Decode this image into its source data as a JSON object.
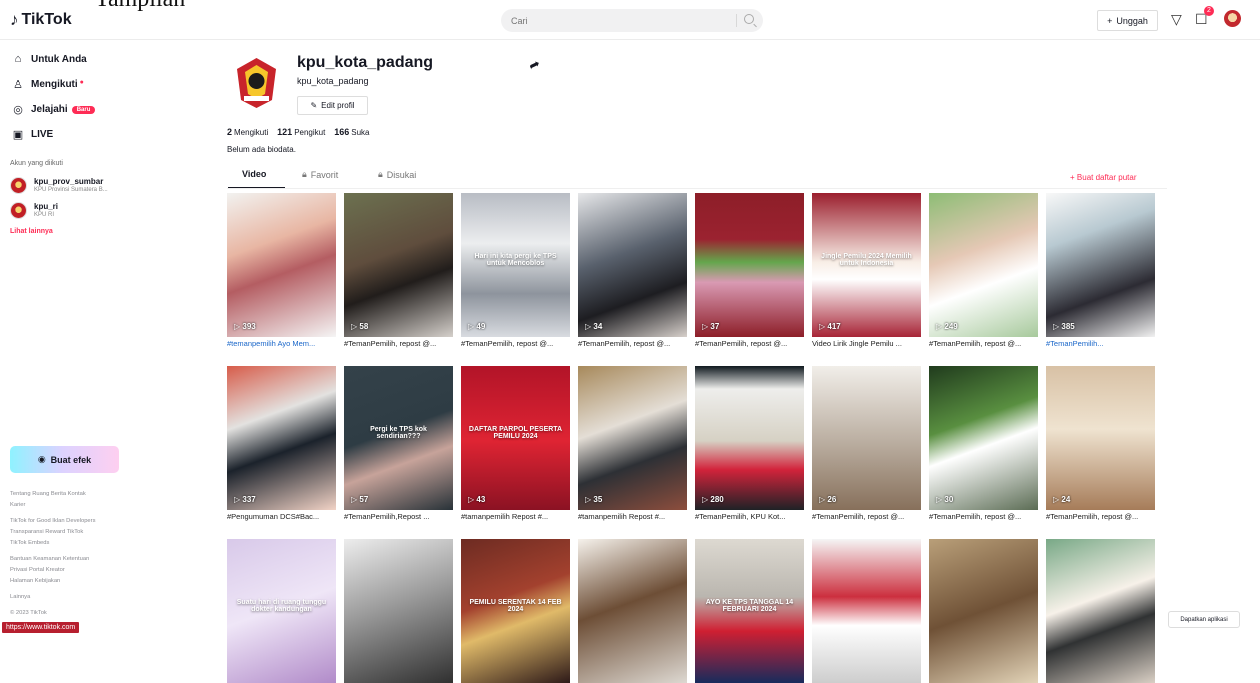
{
  "overlay_text": "Tampilan",
  "topbar": {
    "logo": "TikTok",
    "search_placeholder": "Cari",
    "upload_label": "Unggah",
    "notification_count": "2"
  },
  "sidebar": {
    "items": [
      {
        "label": "Untuk Anda"
      },
      {
        "label": "Mengikuti"
      },
      {
        "label": "Jelajahi",
        "pill": "Baru"
      },
      {
        "label": "LIVE"
      }
    ],
    "section_title": "Akun yang diikuti",
    "following": [
      {
        "name": "kpu_prov_sumbar",
        "sub": "KPU Provinsi Sumatera B..."
      },
      {
        "name": "kpu_ri",
        "sub": "KPU RI"
      }
    ],
    "more_label": "Lihat lainnya",
    "effect_label": "Buat efek",
    "footer": [
      "Tentang Ruang Berita Kontak",
      "Karier",
      "TikTok for Good Iklan Developers",
      "Transparansi Reward TikTok",
      "TikTok Embeds",
      "Bantuan Keamanan Ketentuan",
      "Privasi Portal Kreator",
      "Halaman Kebijakan",
      "Lainnya",
      "© 2023 TikTok"
    ],
    "url": "https://www.tiktok.com"
  },
  "profile": {
    "username": "kpu_kota_padang",
    "subname": "kpu_kota_padang",
    "edit_label": "Edit profil",
    "following_count": "2",
    "following_label": "Mengikuti",
    "followers_count": "121",
    "followers_label": "Pengikut",
    "likes_count": "166",
    "likes_label": "Suka",
    "bio": "Belum ada biodata."
  },
  "tabs": {
    "video": "Video",
    "favorite": "Favorit",
    "liked": "Disukai",
    "playlist": "Buat daftar putar"
  },
  "videos": [
    {
      "views": "393",
      "caption": "#temanpemilih Ayo Mem...",
      "tag": true
    },
    {
      "views": "58",
      "caption": "#TemanPemilih, repost @...",
      "tag": false,
      "overlay": ""
    },
    {
      "views": "49",
      "caption": "#TemanPemilih, repost @...",
      "overlay": "Hari ini kita pergi ke TPS untuk Mencoblos"
    },
    {
      "views": "34",
      "caption": "#TemanPemilih, repost @..."
    },
    {
      "views": "37",
      "caption": "#TemanPemilih, repost @..."
    },
    {
      "views": "417",
      "caption": "Video Lirik Jingle Pemilu ...",
      "overlay": "Jingle Pemilu 2024 Memilih untuk Indonesia"
    },
    {
      "views": "249",
      "caption": "#TemanPemilih, repost @..."
    },
    {
      "views": "385",
      "caption": "#TemanPemilih..."
    },
    {
      "views": "337",
      "caption": "#Pengumuman DCS#Bac..."
    },
    {
      "views": "57",
      "caption": "#TemanPemilih,Repost ...",
      "overlay": "Pergi ke TPS kok sendirian???"
    },
    {
      "views": "43",
      "caption": "#tamanpemilih Repost #...",
      "overlay": "DAFTAR PARPOL PESERTA PEMILU 2024"
    },
    {
      "views": "35",
      "caption": "#tamanpemilih Repost #..."
    },
    {
      "views": "280",
      "caption": "#TemanPemilih, KPU Kot..."
    },
    {
      "views": "26",
      "caption": "#TemanPemilih, repost @..."
    },
    {
      "views": "30",
      "caption": "#TemanPemilih, repost @..."
    },
    {
      "views": "24",
      "caption": "#TemanPemilih, repost @..."
    },
    {
      "views": "",
      "caption": "",
      "overlay": "Suatu hari di ruang tunggu dokter kandungan"
    },
    {
      "views": "",
      "caption": ""
    },
    {
      "views": "",
      "caption": "",
      "overlay": "PEMILU SERENTAK 14 FEB 2024"
    },
    {
      "views": "",
      "caption": ""
    },
    {
      "views": "",
      "caption": "",
      "overlay": "AYO KE TPS TANGGAL 14 FEBRUARI 2024"
    },
    {
      "views": "",
      "caption": ""
    },
    {
      "views": "",
      "caption": ""
    },
    {
      "views": "",
      "caption": ""
    }
  ],
  "get_app": "Dapatkan aplikasi",
  "colors": {
    "accent": "#fe2c55",
    "hashtag": "#1b67c9"
  }
}
